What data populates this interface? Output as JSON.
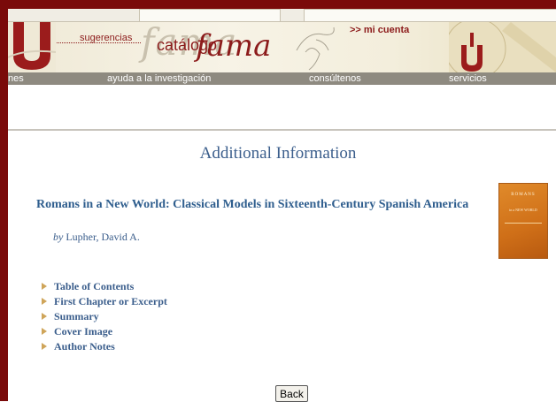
{
  "banner": {
    "sugerencias": "sugerencias",
    "catalogo": "catálogo",
    "fama": "fama",
    "watermark": "fama",
    "mi_cuenta": ">> mi cuenta"
  },
  "nav": {
    "items": [
      {
        "label": "nes"
      },
      {
        "label": "ayuda a la investigación"
      },
      {
        "label": "consúltenos"
      },
      {
        "label": "servicios"
      }
    ]
  },
  "page": {
    "title": "Additional Information",
    "book_title": "Romans in a New World: Classical Models in Sixteenth-Century Spanish America",
    "by": "by",
    "author": "Lupher, David A.",
    "cover": {
      "line1": "ROMANS",
      "line2": "in a NEW WORLD"
    }
  },
  "links": [
    {
      "label": "Table of Contents"
    },
    {
      "label": "First Chapter or Excerpt"
    },
    {
      "label": "Summary"
    },
    {
      "label": "Cover Image"
    },
    {
      "label": "Author Notes"
    }
  ],
  "buttons": {
    "back": "Back"
  },
  "colors": {
    "frame": "#7a0a0a",
    "link": "#3b5e8c",
    "title": "#2f5e8e",
    "navbar": "#8e8a80",
    "accent": "#8c1b1b"
  }
}
